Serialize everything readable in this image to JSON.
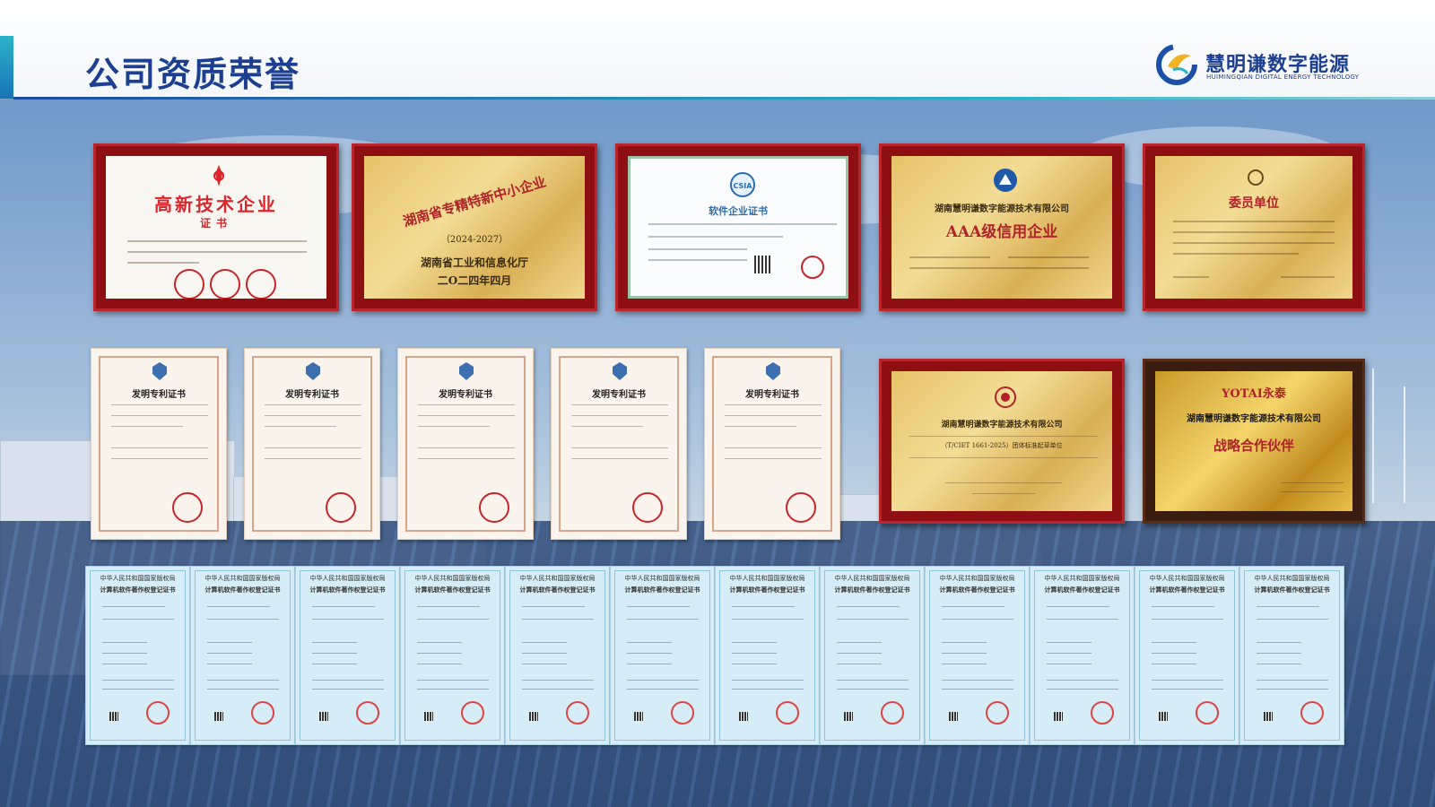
{
  "header": {
    "title": "公司资质荣誉",
    "logo_cn": "慧明谦数字能源",
    "logo_en": "HUIMINGQIAN DIGITAL ENERGY TECHNOLOGY",
    "logo_icon": "hm-logo-icon"
  },
  "colors": {
    "title_blue": "#1d3f8f",
    "accent_teal": "#2bb3c7",
    "frame_red": "#8d0f12",
    "gold": "#e6c36a"
  },
  "plaques_row1": [
    {
      "line1": "高新技术企业",
      "line2": "证书"
    },
    {
      "line1": "湖南省专精特新中小企业",
      "line2": "（2024-2027）",
      "line3": "湖南省工业和信息化厅",
      "line4": "二O二四年四月"
    },
    {
      "line1": "软件企业证书",
      "badge": "CSIA"
    },
    {
      "line1": "湖南慧明谦数字能源技术有限公司",
      "line2": "AAA级信用企业"
    },
    {
      "line1": "委员单位"
    }
  ],
  "plaques_row2": [
    {
      "line1": "湖南慧明谦数字能源技术有限公司",
      "line2": "（T/CIET 1661-2025）团体标准起草单位"
    },
    {
      "line1": "YOTAI永泰",
      "line2": "湖南慧明谦数字能源技术有限公司",
      "line3": "战略合作伙伴"
    }
  ],
  "patents": [
    {
      "title": "发明专利证书"
    },
    {
      "title": "发明专利证书"
    },
    {
      "title": "发明专利证书"
    },
    {
      "title": "发明专利证书"
    },
    {
      "title": "发明专利证书"
    }
  ],
  "software_certs": [
    {
      "line1": "中华人民共和国国家版权局",
      "line2": "计算机软件著作权登记证书"
    },
    {
      "line1": "中华人民共和国国家版权局",
      "line2": "计算机软件著作权登记证书"
    },
    {
      "line1": "中华人民共和国国家版权局",
      "line2": "计算机软件著作权登记证书"
    },
    {
      "line1": "中华人民共和国国家版权局",
      "line2": "计算机软件著作权登记证书"
    },
    {
      "line1": "中华人民共和国国家版权局",
      "line2": "计算机软件著作权登记证书"
    },
    {
      "line1": "中华人民共和国国家版权局",
      "line2": "计算机软件著作权登记证书"
    },
    {
      "line1": "中华人民共和国国家版权局",
      "line2": "计算机软件著作权登记证书"
    },
    {
      "line1": "中华人民共和国国家版权局",
      "line2": "计算机软件著作权登记证书"
    },
    {
      "line1": "中华人民共和国国家版权局",
      "line2": "计算机软件著作权登记证书"
    },
    {
      "line1": "中华人民共和国国家版权局",
      "line2": "计算机软件著作权登记证书"
    },
    {
      "line1": "中华人民共和国国家版权局",
      "line2": "计算机软件著作权登记证书"
    },
    {
      "line1": "中华人民共和国国家版权局",
      "line2": "计算机软件著作权登记证书"
    }
  ]
}
